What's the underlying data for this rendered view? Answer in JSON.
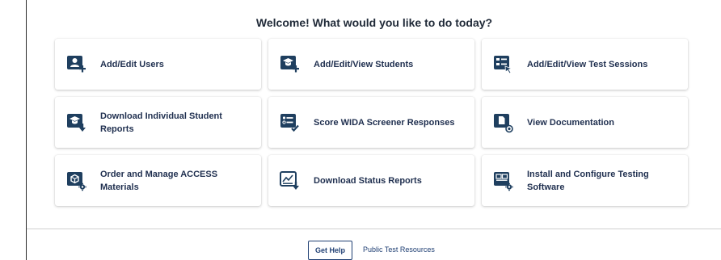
{
  "header": {
    "title": "Welcome! What would you like to do today?"
  },
  "cards": [
    {
      "label": "Add/Edit Users",
      "icon": "user-add-icon"
    },
    {
      "label": "Add/Edit/View Students",
      "icon": "student-add-icon"
    },
    {
      "label": "Add/Edit/View Test Sessions",
      "icon": "test-sessions-icon"
    },
    {
      "label": "Download Individual Student Reports",
      "icon": "student-download-icon"
    },
    {
      "label": "Score WIDA Screener Responses",
      "icon": "score-checklist-icon"
    },
    {
      "label": "View Documentation",
      "icon": "document-view-icon"
    },
    {
      "label": "Order and Manage ACCESS Materials",
      "icon": "box-gear-icon"
    },
    {
      "label": "Download Status Reports",
      "icon": "chart-download-icon"
    },
    {
      "label": "Install and Configure Testing Software",
      "icon": "windows-gear-icon"
    }
  ],
  "footer": {
    "help_label": "Get Help",
    "resources_label": "Public Test Resources"
  },
  "colors": {
    "icon_dark": "#1f3f5f",
    "text_dark": "#1f2f4f"
  }
}
